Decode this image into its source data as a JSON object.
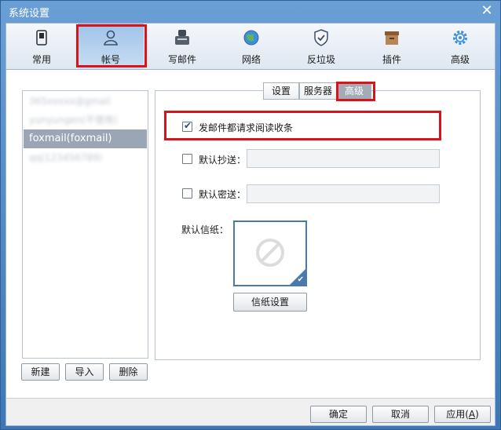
{
  "window": {
    "title": "系统设置"
  },
  "toolbar": {
    "items": [
      {
        "label": "常用",
        "icon": "phone-icon"
      },
      {
        "label": "帐号",
        "icon": "user-icon"
      },
      {
        "label": "写邮件",
        "icon": "compose-icon"
      },
      {
        "label": "网络",
        "icon": "globe-icon"
      },
      {
        "label": "反垃圾",
        "icon": "shield-icon"
      },
      {
        "label": "插件",
        "icon": "plugin-box-icon"
      },
      {
        "label": "高级",
        "icon": "gear-icon"
      }
    ],
    "active_label": "帐号"
  },
  "accounts": {
    "items": [
      {
        "label": "365xxxxx@gmail",
        "blurred": true
      },
      {
        "label": "yunyungen(不使用)",
        "blurred": true
      },
      {
        "label": "foxmail(foxmail)",
        "blurred": false
      },
      {
        "label": "qq(123456789)",
        "blurred": true
      }
    ],
    "selected": "foxmail(foxmail)"
  },
  "account_buttons": {
    "new": "新建",
    "import": "导入",
    "delete": "删除"
  },
  "subtabs": {
    "settings": "设置",
    "server": "服务器",
    "advanced": "高级",
    "active": "高级"
  },
  "advanced": {
    "read_receipt": {
      "label": "发邮件都请求阅读收条",
      "checked": true
    },
    "default_cc": {
      "label": "默认抄送：",
      "checked": false,
      "value": ""
    },
    "default_bcc": {
      "label": "默认密送：",
      "checked": false,
      "value": ""
    },
    "stationery_label": "默认信纸：",
    "stationery_button": "信纸设置"
  },
  "footer": {
    "ok": "确定",
    "cancel": "取消",
    "apply_prefix": "应用(",
    "apply_hotkey": "A",
    "apply_suffix": ")"
  },
  "colors": {
    "titlebar": "#4a84c4",
    "highlight": "#d8141a",
    "selected_row": "#9aa6b5"
  }
}
